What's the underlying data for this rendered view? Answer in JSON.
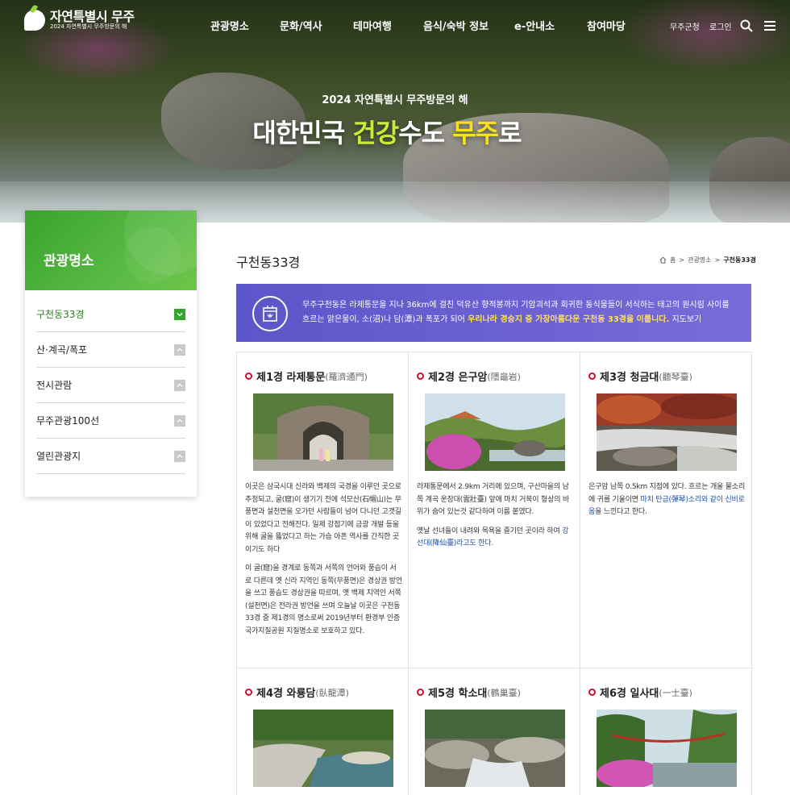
{
  "header": {
    "logo_main": "자연특별시 무주",
    "logo_sub": "2024 자연특별시 무주방문의 해",
    "nav": [
      "관광명소",
      "문화/역사",
      "테마여행",
      "음식/숙박 정보",
      "e-안내소",
      "참여마당"
    ],
    "util_links": [
      "무주군청",
      "로그인"
    ]
  },
  "hero": {
    "subtitle": "2024 자연특별시 무주방문의 해",
    "title_a": "대한민국 ",
    "title_b": "건강",
    "title_c": "수도 ",
    "title_d": "무주",
    "title_e": "로"
  },
  "sidebar": {
    "title": "관광명소",
    "items": [
      {
        "label": "구천동33경",
        "active": true
      },
      {
        "label": "산·계곡/폭포",
        "active": false
      },
      {
        "label": "전시관람",
        "active": false
      },
      {
        "label": "무주관광100선",
        "active": false
      },
      {
        "label": "열린관광지",
        "active": false
      }
    ]
  },
  "main": {
    "page_title": "구천동33경",
    "breadcrumb": [
      "홈",
      "관광명소",
      "구천동33경"
    ],
    "banner": {
      "text_a": "무주구천동은 라제통문을 지나 36km에 걸친 덕유산 향적봉까지 기암괴석과 회귀한 동식물들이 서식하는 태고의 원시림 사이를 흐르는 맑은물이, 소(沼)나 담(潭)과 폭포가 되어 ",
      "text_hl": "우리나라 경승지 중 가장아름다운 구천동 33경을 이룹니다.",
      "text_b": " 지도보기"
    },
    "cards": [
      {
        "title": "제1경 라제통문",
        "hanja": "(羅濟通門)",
        "p1": "이곳은 삼국시대 신라와 백제의 국경을 이루던 곳으로 추정되고, 굴(窟)이 생기기 전에 석모산(石帽山)는 무풍면과 설천면을 오가던 사람들이 넘어 다니던 고갯길이 있었다고 전해진다. 일제 강점기에 금광 개발 등을 위해 굴을 뚫었다고 하는 가슴 아픈 역사를 간직한 곳이기도 하다",
        "p2": "이 굴(窟)을 경계로 동쪽과 서쪽의 언어와 풍습이 서로 다른데 옛 신라 지역인 동쪽(무풍면)은 경상권 방언을 쓰고 풍습도 경상권을 따르며, 옛 백제 지역인 서쪽(설천면)은 전라권 방언을 쓰며 오늘날 이곳은 구천동 33경 중 제1경의 명소로써 2019년부터 환경부 인증 국가지질공원 지질명소로 보호하고 있다.",
        "p2_link": ""
      },
      {
        "title": "제2경 은구암",
        "hanja": "(隱龜岩)",
        "p1": "라제통문에서 2.9km 거리에 있으며, 구산마을의 남쪽 계곡 운장대(雲壯臺) 앞에 마치 거북이 형상의 바위가 숨어 있는것 같다하여 이름 붙였다.",
        "p2": "옛날 선녀들이 내려와 목욕을 즐기던 곳이라 하여 ",
        "p2_link": "강선대(降仙臺)라고도 한다."
      },
      {
        "title": "제3경 청금대",
        "hanja": "(聽琴臺)",
        "p1": "은구암 남쪽 0.5km 지점에 있다. 흐르는 개울 물소리에 귀를 기울이면 ",
        "p1_link": "마치 탄금(彈琴)소리와 같이 신비로움",
        "p1_tail": "을 느낀다고 한다.",
        "p2": "",
        "p2_link": ""
      },
      {
        "title": "제4경 와룡담",
        "hanja": "(臥龍潭)"
      },
      {
        "title": "제5경 학소대",
        "hanja": "(鶴巢臺)"
      },
      {
        "title": "제6경 일사대",
        "hanja": "(一士臺)"
      }
    ]
  },
  "colors": {
    "sidebar_green": "#3aa42e",
    "banner_purple": "#5b56c9",
    "highlight_yellow": "#ffe44d",
    "hero_green": "#c7ec39",
    "hero_yellow": "#f7e21a",
    "bullet_red": "#c8102e",
    "link_blue": "#1b4fa8"
  },
  "icons": [
    "search-icon",
    "menu-icon",
    "home-icon",
    "map-icon",
    "chevron-down-icon",
    "chevron-up-icon"
  ]
}
